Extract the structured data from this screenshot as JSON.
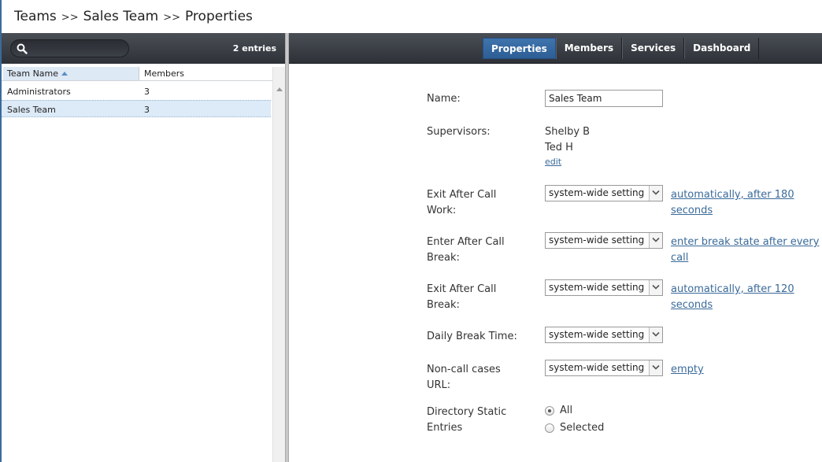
{
  "breadcrumb": {
    "items": [
      "Teams",
      "Sales Team",
      "Properties"
    ],
    "separator": ">>"
  },
  "left": {
    "search": {
      "placeholder": ""
    },
    "entries": "2 entries",
    "columns": {
      "team_name": "Team Name",
      "members": "Members"
    },
    "rows": [
      {
        "name": "Administrators",
        "members": "3"
      },
      {
        "name": "Sales Team",
        "members": "3"
      }
    ]
  },
  "tabs": [
    "Properties",
    "Members",
    "Services",
    "Dashboard"
  ],
  "form": {
    "name_label": "Name:",
    "name_value": "Sales Team",
    "supervisors_label": "Supervisors:",
    "supervisors": [
      "Shelby B",
      "Ted H"
    ],
    "edit": "edit",
    "exit_acw_label": [
      "Exit After Call",
      "Work:"
    ],
    "exit_acw_value": "system-wide setting",
    "exit_acw_hint": [
      "automatically, after 180",
      "seconds"
    ],
    "enter_acb_label": [
      "Enter After Call",
      "Break:"
    ],
    "enter_acb_value": "system-wide setting",
    "enter_acb_hint": [
      "enter break state after every",
      "call"
    ],
    "exit_acb_label": [
      "Exit After Call",
      "Break:"
    ],
    "exit_acb_value": "system-wide setting",
    "exit_acb_hint": [
      "automatically, after 120",
      "seconds"
    ],
    "daily_break_label": "Daily Break Time:",
    "daily_break_value": "system-wide setting",
    "noncall_label": [
      "Non-call cases",
      "URL:"
    ],
    "noncall_value": "system-wide setting",
    "noncall_hint": "empty",
    "directory_label": [
      "Directory Static",
      "Entries"
    ],
    "directory_options": [
      "All",
      "Selected"
    ],
    "directory_selected": "All"
  },
  "colors": {
    "toolbar": "#2e3238",
    "active_tab": "#3f74ae",
    "link": "#3a6a9a",
    "selected_row": "#ddeaf7"
  }
}
